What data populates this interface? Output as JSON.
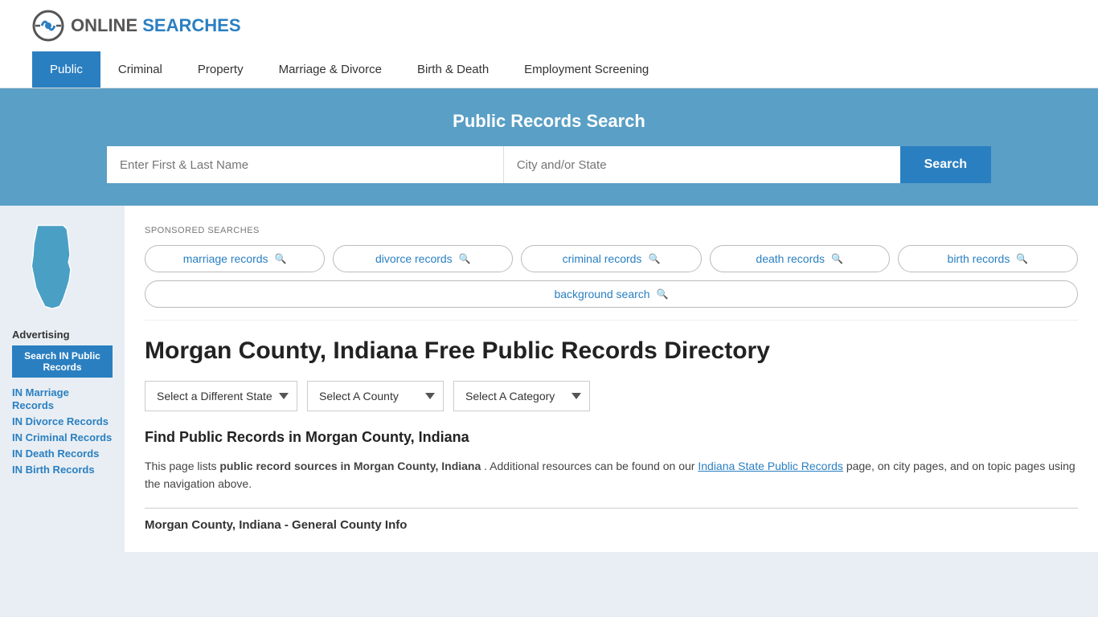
{
  "header": {
    "logo_text_online": "ONLINE",
    "logo_text_searches": "SEARCHES"
  },
  "nav": {
    "items": [
      {
        "label": "Public",
        "active": true
      },
      {
        "label": "Criminal",
        "active": false
      },
      {
        "label": "Property",
        "active": false
      },
      {
        "label": "Marriage & Divorce",
        "active": false
      },
      {
        "label": "Birth & Death",
        "active": false
      },
      {
        "label": "Employment Screening",
        "active": false
      }
    ]
  },
  "search_banner": {
    "title": "Public Records Search",
    "name_placeholder": "Enter First & Last Name",
    "location_placeholder": "City and/or State",
    "button_label": "Search"
  },
  "sponsored": {
    "label": "SPONSORED SEARCHES",
    "tags": [
      {
        "label": "marriage records"
      },
      {
        "label": "divorce records"
      },
      {
        "label": "criminal records"
      },
      {
        "label": "death records"
      },
      {
        "label": "birth records"
      },
      {
        "label": "background search"
      }
    ]
  },
  "page": {
    "title": "Morgan County, Indiana Free Public Records Directory",
    "dropdown_state": "Select a Different State",
    "dropdown_county": "Select A County",
    "dropdown_category": "Select A Category",
    "find_heading": "Find Public Records in Morgan County, Indiana",
    "description_part1": "This page lists ",
    "description_bold": "public record sources in Morgan County, Indiana",
    "description_part2": ". Additional resources can be found on our ",
    "description_link": "Indiana State Public Records",
    "description_part3": " page, on city pages, and on topic pages using the navigation above.",
    "county_info_heading": "Morgan County, Indiana - General County Info"
  },
  "sidebar": {
    "advertising_label": "Advertising",
    "ad_button_label": "Search IN Public Records",
    "links": [
      {
        "label": "IN Marriage Records"
      },
      {
        "label": "IN Divorce Records"
      },
      {
        "label": "IN Criminal Records"
      },
      {
        "label": "IN Death Records"
      },
      {
        "label": "IN Birth Records"
      }
    ]
  },
  "colors": {
    "nav_active_bg": "#2a7fc1",
    "banner_bg": "#5a9fc5",
    "search_button": "#2a7fc1",
    "link_color": "#2a7fc1",
    "map_fill": "#4a9fc5"
  }
}
